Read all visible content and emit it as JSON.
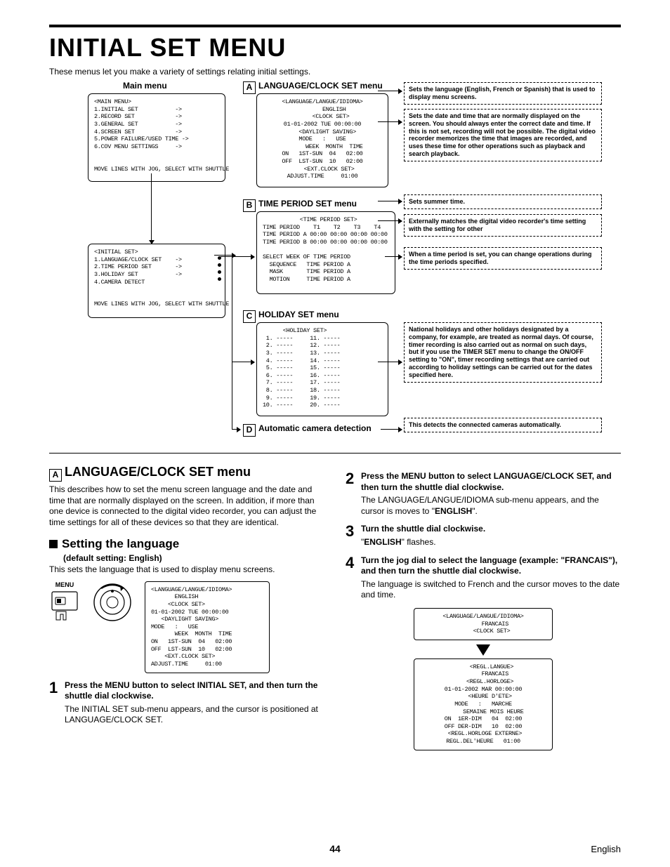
{
  "title": "INITIAL SET MENU",
  "intro": "These menus let you make a variety of settings relating initial settings.",
  "diag": {
    "main_menu_label": "Main menu",
    "main_menu_screen": "<MAIN MENU>\n1.INITIAL SET           ->\n2.RECORD SET            ->\n3.GENERAL SET           ->\n4.SCREEN SET            ->\n5.POWER FAILURE/USED TIME ->\n6.COV MENU SETTINGS     ->\n\n\nMOVE LINES WITH JOG, SELECT WITH SHUTTLE",
    "initial_set_screen": "<INITIAL SET>\n1.LANGUAGE/CLOCK SET    ->\n2.TIME PERIOD SET       ->\n3.HOLIDAY SET           ->\n4.CAMERA DETECT\n\n\nMOVE LINES WITH JOG, SELECT WITH SHUTTLE",
    "menu_a_label": "LANGUAGE/CLOCK SET menu",
    "menu_a_screen": "<LANGUAGE/LANGUE/IDIOMA>\n       ENGLISH\n     <CLOCK SET>\n01-01-2002 TUE 00:00:00\n   <DAYLIGHT SAVING>\nMODE   :   USE\n       WEEK  MONTH  TIME\nON   1ST-SUN  04   02:00\nOFF  LST-SUN  10   02:00\n    <EXT.CLOCK SET>\nADJUST.TIME     01:00",
    "menu_b_label": "TIME PERIOD SET menu",
    "menu_b_screen": "           <TIME PERIOD SET>\nTIME PERIOD    T1    T2    T3    T4\nTIME PERIOD A 00:00 00:00 00:00 00:00\nTIME PERIOD B 00:00 00:00 00:00 00:00\n\nSELECT WEEK OF TIME PERIOD\n  SEQUENCE   TIME PERIOD A\n  MASK       TIME PERIOD A\n  MOTION     TIME PERIOD A",
    "menu_c_label": "HOLIDAY SET menu",
    "menu_c_screen": "      <HOLIDAY SET>\n 1. -----     11. -----\n 2. -----     12. -----\n 3. -----     13. -----\n 4. -----     14. -----\n 5. -----     15. -----\n 6. -----     16. -----\n 7. -----     17. -----\n 8. -----     18. -----\n 9. -----     19. -----\n10. -----     20. -----",
    "menu_d_label": "Automatic camera detection",
    "call_a1": "Sets the language (English, French or Spanish) that is used to display menu screens.",
    "call_a2": "Sets the date and time that are normally displayed on the screen.\nYou should always enter the correct date and time. If this is not set, recording will not be possible. The digital video recorder memorizes the time that images are recorded, and uses these time for other operations such as playback and search playback.",
    "call_a3": "Sets summer time.",
    "call_a4": "Externally matches the digital video recorder's time setting with the setting for other",
    "call_b": "When a time period is set, you can change operations during the time periods specified.",
    "call_c": "National holidays and other holidays designated by a company, for example, are treated as normal days. Of course, timer recording is also carried out as normal on such days, but if you use the TIMER SET menu to change the ON/OFF setting to \"ON\", timer recording settings that are carried out according to holiday settings can be carried out for the dates specified here.",
    "call_d": "This detects the connected cameras automatically."
  },
  "section_a_heading": "LANGUAGE/CLOCK SET menu",
  "section_a_body": "This describes how to set the menu screen language and the date and time that are normally displayed on the screen. In addition, if more than one device is connected to the digital video recorder, you can adjust the time settings for all of these devices so that they are identical.",
  "setting_lang_heading": "Setting the language",
  "default_line": "(default setting: English)",
  "setting_lang_body": "This sets the language that is used to display menu screens.",
  "menu_label": "MENU",
  "mini_screen_a": "<LANGUAGE/LANGUE/IDIOMA>\n       ENGLISH\n     <CLOCK SET>\n01-01-2002 TUE 00:00:00\n   <DAYLIGHT SAVING>\nMODE   :   USE\n       WEEK  MONTH  TIME\nON   1ST-SUN  04   02:00\nOFF  LST-SUN  10   02:00\n    <EXT.CLOCK SET>\nADJUST.TIME     01:00",
  "steps": [
    {
      "num": "1",
      "head": "Press the MENU button to select INITIAL SET, and then turn the shuttle dial clockwise.",
      "text": "The INITIAL SET sub-menu appears, and the cursor is positioned at LANGUAGE/CLOCK SET."
    },
    {
      "num": "2",
      "head": "Press the MENU button to select LANGUAGE/CLOCK SET, and then turn the shuttle dial clockwise.",
      "text": "The LANGUAGE/LANGUE/IDIOMA sub-menu appears, and the cursor is moves to \"ENGLISH\"."
    },
    {
      "num": "3",
      "head": "Turn the shuttle dial clockwise.",
      "text": "\"ENGLISH\" flashes."
    },
    {
      "num": "4",
      "head": "Turn the jog dial to select the language (example: \"FRANCAIS\"), and then turn the shuttle dial clockwise.",
      "text": "The language is switched to French and the cursor moves to the date and time."
    }
  ],
  "french_screen_top": "<LANGUAGE/LANGUE/IDIOMA>\n       FRANCAIS\n     <CLOCK SET>",
  "french_screen_bot": "     <REGL.LANGUE>\n       FRANCAIS\n    <REGL.HORLOGE>\n01-01-2002 MAR 00:00:00\n    <HEURE D'ETE>\nMODE   :   MARCHE\n      SEMAINE MOIS HEURE\nON  1ER-DIM   04  02:00\nOFF DER-DIM   10  02:00\n <REGL.HORLOGE EXTERNE>\nREGL.DEL'HEURE   01:00",
  "page_num": "44",
  "english_label": "English"
}
